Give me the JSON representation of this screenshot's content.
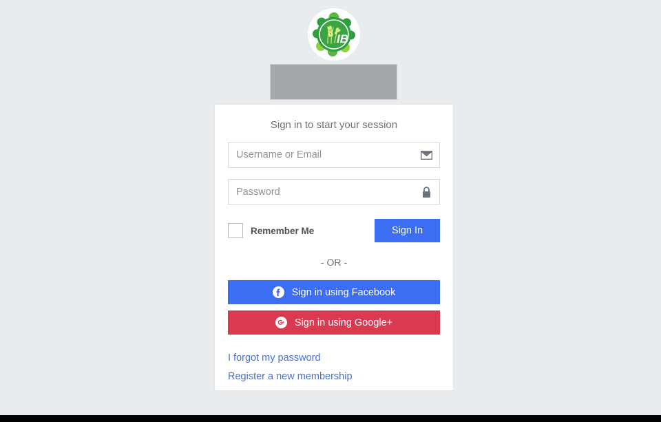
{
  "page": {
    "background_color": "#e9ecef",
    "bottom_bar_color": "#000000"
  },
  "logo": {
    "icon_name": "ib-gear-wheat-logo",
    "monogram": "IB",
    "colors": {
      "dark_green": "#2f9e3f",
      "mid_green": "#56b83c",
      "light_green": "#8fd040",
      "ring": "#ffffff"
    }
  },
  "banner": {
    "icon_name": "broken-image-placeholder",
    "color": "#a5a8ab"
  },
  "card": {
    "message": "Sign in to start your session",
    "background_color": "#ffffff"
  },
  "form": {
    "username": {
      "value": "",
      "placeholder": "Username or Email",
      "icon_name": "envelope-icon"
    },
    "password": {
      "value": "",
      "placeholder": "Password",
      "icon_name": "lock-icon"
    },
    "remember_me": {
      "label": "Remember Me",
      "checked": false
    },
    "submit": {
      "label": "Sign In",
      "color": "#3c6ef4"
    }
  },
  "divider": {
    "label": "- OR -"
  },
  "social": {
    "facebook": {
      "label": "Sign in using Facebook",
      "icon_name": "facebook-icon",
      "color": "#3c6ef4"
    },
    "google": {
      "label": "Sign in using Google+",
      "icon_name": "google-plus-icon",
      "color": "#d93a52"
    }
  },
  "links": {
    "forgot_password": "I forgot my password",
    "register": "Register a new membership",
    "color": "#4a6fd4"
  }
}
